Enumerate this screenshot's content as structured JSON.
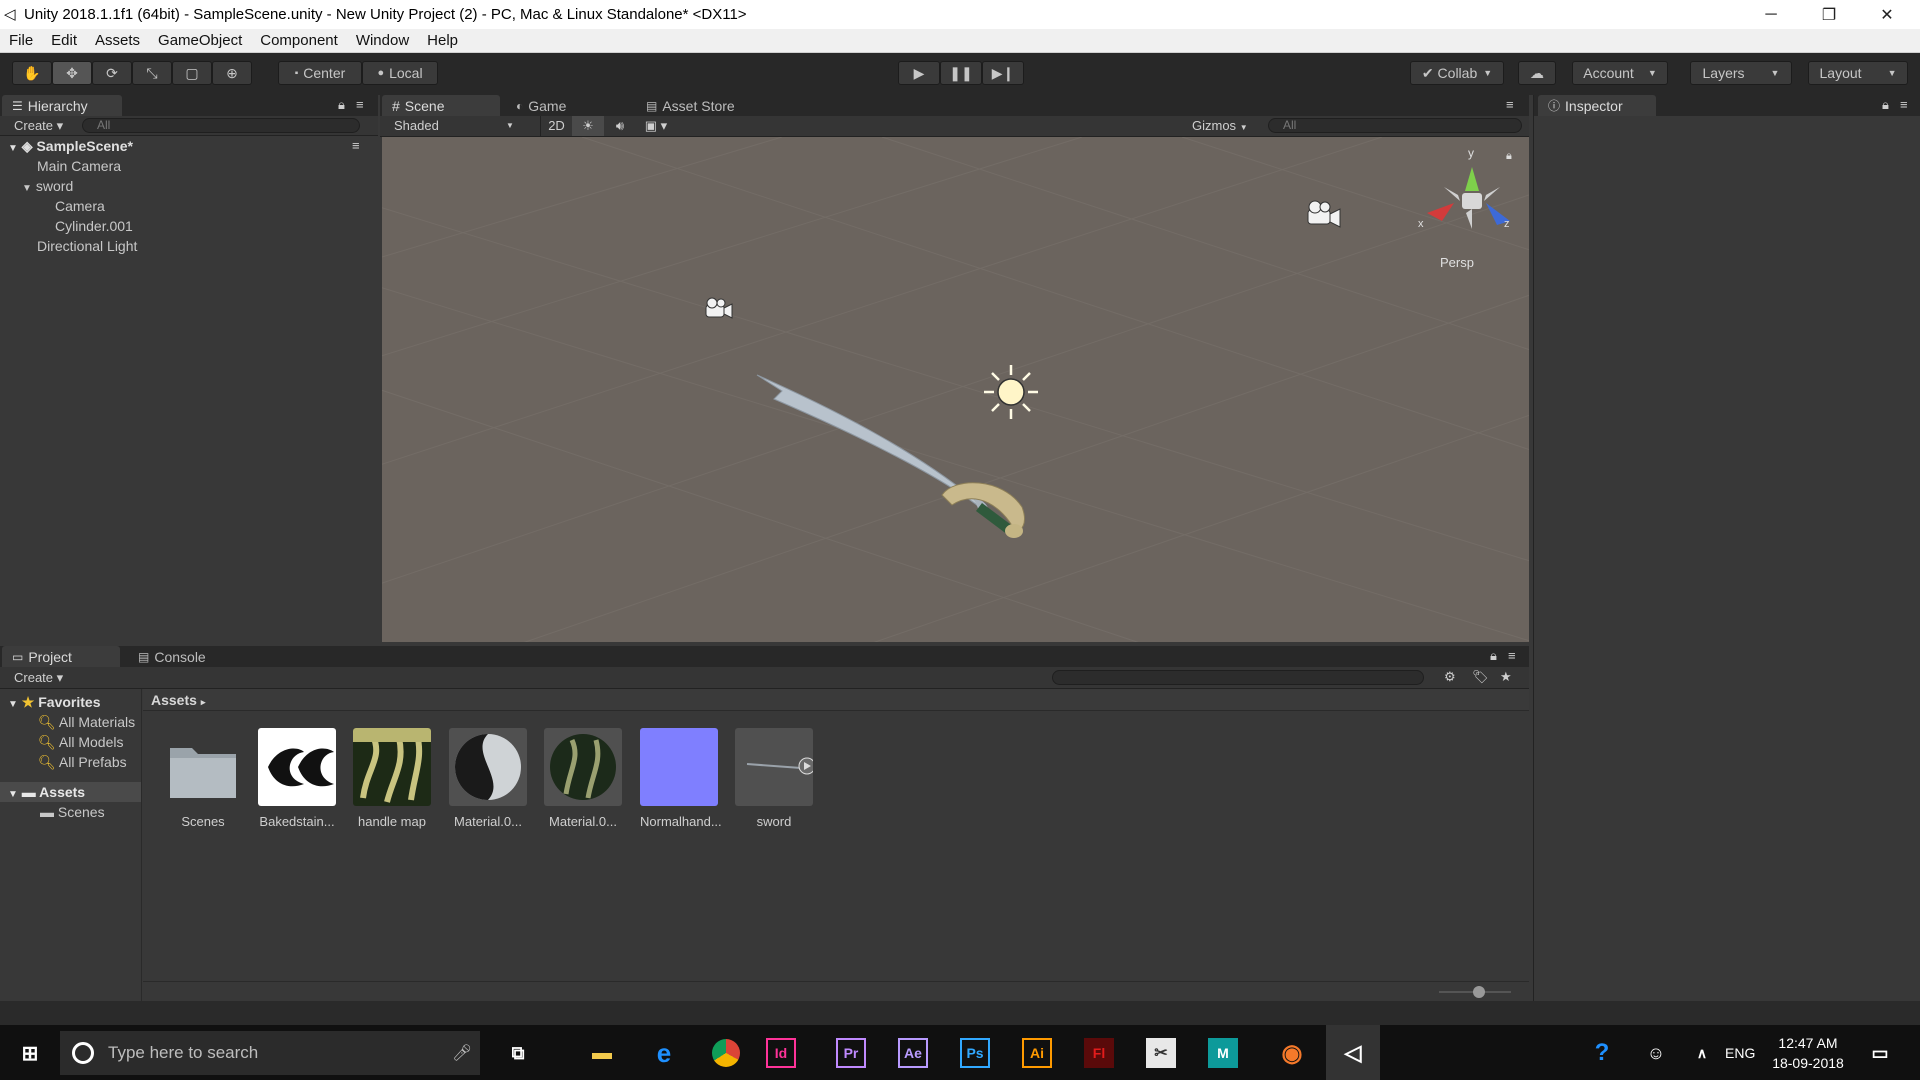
{
  "window": {
    "title": "Unity 2018.1.1f1 (64bit) - SampleScene.unity - New Unity Project (2) - PC, Mac & Linux Standalone* <DX11>"
  },
  "menu": [
    "File",
    "Edit",
    "Assets",
    "GameObject",
    "Component",
    "Window",
    "Help"
  ],
  "toolbar": {
    "center": "Center",
    "local": "Local",
    "collab": "Collab",
    "account": "Account",
    "layers": "Layers",
    "layout": "Layout"
  },
  "hierarchy": {
    "tab": "Hierarchy",
    "create": "Create",
    "search_placeholder": "All",
    "scene": "SampleScene*",
    "items": [
      "Main Camera",
      "sword",
      "Camera",
      "Cylinder.001",
      "Directional Light"
    ]
  },
  "scene": {
    "tabs": [
      "Scene",
      "Game",
      "Asset Store"
    ],
    "shading": "Shaded",
    "mode2d": "2D",
    "gizmos": "Gizmos",
    "search_placeholder": "All",
    "persp": "Persp",
    "axis_x": "x",
    "axis_y": "y",
    "axis_z": "z"
  },
  "inspector": {
    "tab": "Inspector"
  },
  "project": {
    "tabs": [
      "Project",
      "Console"
    ],
    "create": "Create",
    "favorites": "Favorites",
    "favorite_items": [
      "All Materials",
      "All Models",
      "All Prefabs"
    ],
    "assets_root": "Assets",
    "assets_children": [
      "Scenes"
    ],
    "breadcrumb": "Assets",
    "assets": [
      "Scenes",
      "Bakedstain...",
      "handle map",
      "Material.0...",
      "Material.0...",
      "Normalhand...",
      "sword"
    ]
  },
  "taskbar": {
    "search_placeholder": "Type here to search",
    "lang": "ENG",
    "time": "12:47 AM",
    "date": "18-09-2018"
  },
  "colors": {
    "scene_bg": "#6b645e",
    "normal_map": "#7f7fff",
    "unity_dark": "#383838"
  }
}
